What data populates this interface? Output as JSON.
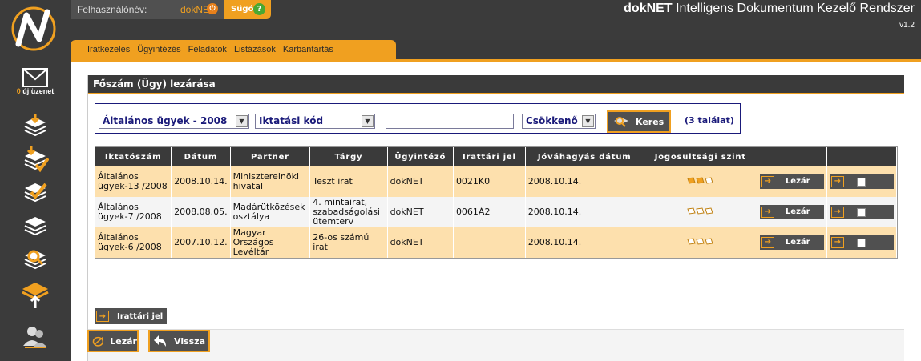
{
  "user": {
    "label": "Felhasználónév:",
    "name": "dokNET"
  },
  "help": {
    "label": "Súgó"
  },
  "app": {
    "brand": "dokNET",
    "title": "Intelligens Dokumentum Kezelő Rendszer",
    "version": "v1.2"
  },
  "sidebar": {
    "messages": {
      "count": "0",
      "label": "új üzenet"
    }
  },
  "menu": [
    "Iratkezelés",
    "Ügyintézés",
    "Feladatok",
    "Listázások",
    "Karbantartás"
  ],
  "panel": {
    "title": "Főszám (Ügy) lezárása"
  },
  "search": {
    "year_select": "Általános ügyek - 2008",
    "field_select": "Iktatási kód",
    "text_value": "",
    "order_select": "Csökkenő",
    "button": "Keres",
    "result_count": "(3 találat)"
  },
  "table": {
    "headers": [
      "Iktatószám",
      "Dátum",
      "Partner",
      "Tárgy",
      "Ügyintéző",
      "Irattári jel",
      "Jóváhagyás dátum",
      "Jogosultsági szint",
      "",
      ""
    ],
    "rows": [
      {
        "iktatoszam": "Általános ügyek-13 /2008",
        "datum": "2008.10.14.",
        "partner": "Miniszterelnöki hivatal",
        "targy": "Teszt irat",
        "ugyintezo": "dokNET",
        "irattari_jel": "0021K0",
        "jovahagyas": "2008.10.14.",
        "level_filled": 2,
        "action": "Lezár"
      },
      {
        "iktatoszam": "Általános ügyek-7 /2008",
        "datum": "2008.08.05.",
        "partner": "Madárütközések osztálya",
        "targy": "4. mintairat, szabadságolási ütemterv",
        "ugyintezo": "dokNET",
        "irattari_jel": "0061Á2",
        "jovahagyas": "2008.10.14.",
        "level_filled": 0,
        "action": "Lezár"
      },
      {
        "iktatoszam": "Általános ügyek-6 /2008",
        "datum": "2007.10.12.",
        "partner": "Magyar Országos Levéltár",
        "targy": "26-os számú irat",
        "ugyintezo": "dokNET",
        "irattari_jel": "",
        "jovahagyas": "2008.10.14.",
        "level_filled": 0,
        "action": "Lezár"
      }
    ]
  },
  "buttons": {
    "irattari_jel": "Irattári jel",
    "lezar": "Lezár",
    "vissza": "Vissza"
  },
  "colors": {
    "accent": "#f0a020",
    "dark": "#3a3a3a",
    "navy": "#1a1a7a",
    "row_odd": "#fde0ad",
    "row_even": "#f4f4f4"
  }
}
